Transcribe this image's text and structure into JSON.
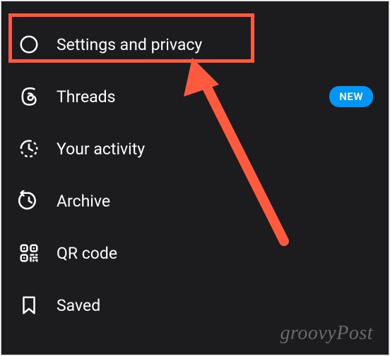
{
  "menu": {
    "items": [
      {
        "label": "Settings and privacy",
        "icon": "gear-icon",
        "badge": null
      },
      {
        "label": "Threads",
        "icon": "threads-icon",
        "badge": "NEW"
      },
      {
        "label": "Your activity",
        "icon": "activity-icon",
        "badge": null
      },
      {
        "label": "Archive",
        "icon": "archive-icon",
        "badge": null
      },
      {
        "label": "QR code",
        "icon": "qrcode-icon",
        "badge": null
      },
      {
        "label": "Saved",
        "icon": "bookmark-icon",
        "badge": null
      }
    ]
  },
  "annotation": {
    "highlighted_item_index": 0,
    "arrow_points_to": "Settings and privacy"
  },
  "watermark": "groovyPost"
}
